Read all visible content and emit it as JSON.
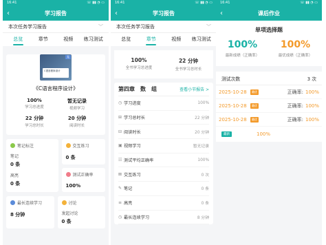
{
  "status": {
    "time": "16:41",
    "icons": "☏ ▮▮ ◔ ▭"
  },
  "colors": {
    "teal": "#1ab2a6",
    "orange": "#f39a2a"
  },
  "screen1": {
    "title": "学习报告",
    "dropdown": "本次任务学习报告",
    "tabs": [
      "总览",
      "章节",
      "视频",
      "练习测试"
    ],
    "course": {
      "badge": "无",
      "cover_text": "C语言程序设计",
      "title": "《C语言程序设计》"
    },
    "stats": [
      {
        "value": "100%",
        "label": "学习总进度"
      },
      {
        "value": "暂无记录",
        "label": "视频学习"
      },
      {
        "value": "22 分钟",
        "label": "学习总时长"
      },
      {
        "value": "20 分钟",
        "label": "阅读时长"
      }
    ],
    "cards": [
      {
        "title": "笔记标注",
        "sub1": "笔记",
        "val1": "0 条",
        "sub2": "高亮",
        "val2": "0 条"
      },
      {
        "title": "交互练习",
        "val": "0 条"
      },
      {
        "title": "测试正确率",
        "val": "100%"
      },
      {
        "title": "最长连续学习",
        "val": "8 分钟"
      },
      {
        "title": "讨论",
        "sub": "发起讨论",
        "val": "0 条"
      }
    ]
  },
  "screen2": {
    "title": "学习报告",
    "dropdown": "本次任务学习报告",
    "tabs": [
      "总览",
      "章节",
      "视频",
      "练习测试"
    ],
    "summary": [
      {
        "value": "100%",
        "label": "全书学习总进度"
      },
      {
        "value": "22 分钟",
        "label": "全书学习总时长"
      }
    ],
    "chapter": {
      "title": "第四章　数　组",
      "link": "查看小节报告 >"
    },
    "items": [
      {
        "icon": "◷",
        "name": "学习进度",
        "value": "100%"
      },
      {
        "icon": "⊞",
        "name": "学习总时长",
        "value": "22 分钟"
      },
      {
        "icon": "⊟",
        "name": "阅读时长",
        "value": "20 分钟"
      },
      {
        "icon": "▣",
        "name": "视频学习",
        "value": "暂无记录"
      },
      {
        "icon": "☷",
        "name": "测试平均正确率",
        "value": "100%"
      },
      {
        "icon": "⊠",
        "name": "交互练习",
        "value": "0 次"
      },
      {
        "icon": "✎",
        "name": "笔记",
        "value": "0 条"
      },
      {
        "icon": "≡",
        "name": "高亮",
        "value": "0 条"
      },
      {
        "icon": "◷",
        "name": "最长连续学习",
        "value": "8 分钟"
      }
    ]
  },
  "screen3": {
    "title": "课后作业",
    "section": "单项选择题",
    "scores": [
      {
        "value": "100%",
        "label": "最新成绩（正确率）",
        "color": "#1ab2a6"
      },
      {
        "value": "100%",
        "label": "最优成绩（正确率）",
        "color": "#f39a2a"
      }
    ],
    "tests_label": "测试次数",
    "tests_count": "3 次",
    "rows": [
      {
        "date": "2025-10-28",
        "badge": "最优",
        "label": "正确率:",
        "pct": "100%"
      },
      {
        "date": "2025-10-28",
        "badge": "最优",
        "label": "正确率:",
        "pct": "100%"
      },
      {
        "date": "2025-10-28",
        "badge": "最优",
        "label": "正确率:",
        "pct": "100%"
      }
    ],
    "avg_badge": "最新",
    "avg_pct": "100%"
  }
}
